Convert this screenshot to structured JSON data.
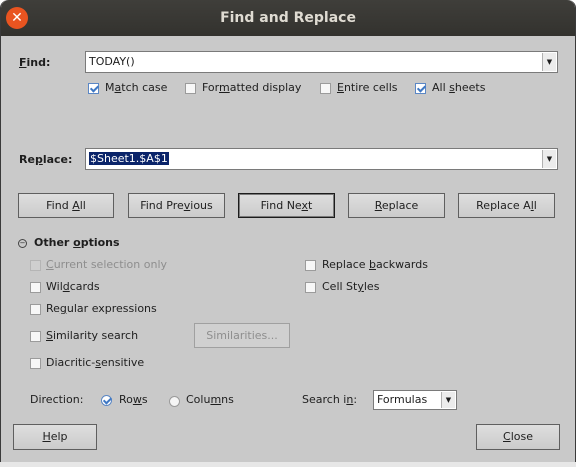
{
  "window": {
    "title": "Find and Replace"
  },
  "find": {
    "label_pre": "",
    "label_key": "F",
    "label_post": "ind:",
    "value": "TODAY()"
  },
  "find_options": {
    "match_case": {
      "pre": "M",
      "key": "a",
      "post": "tch case",
      "checked": true
    },
    "formatted_display": {
      "pre": "For",
      "key": "m",
      "post": "atted display",
      "checked": false
    },
    "entire_cells": {
      "pre": "",
      "key": "E",
      "post": "ntire cells",
      "checked": false
    },
    "all_sheets": {
      "pre": "All ",
      "key": "s",
      "post": "heets",
      "checked": true
    }
  },
  "replace": {
    "label_pre": "Re",
    "label_key": "p",
    "label_post": "lace:",
    "value": "$Sheet1.$A$1"
  },
  "buttons": {
    "find_all": {
      "pre": "Find ",
      "key": "A",
      "post": "ll"
    },
    "find_previous": {
      "pre": "Find Pre",
      "key": "v",
      "post": "ious"
    },
    "find_next": {
      "pre": "Find Ne",
      "key": "x",
      "post": "t"
    },
    "replace": {
      "pre": "",
      "key": "R",
      "post": "eplace"
    },
    "replace_all": {
      "pre": "Replace A",
      "key": "l",
      "post": "l"
    },
    "similarities": "Similarities...",
    "help": {
      "pre": "",
      "key": "H",
      "post": "elp"
    },
    "close": {
      "pre": "",
      "key": "C",
      "post": "lose"
    }
  },
  "other_options": {
    "header_pre": "Other ",
    "header_key": "o",
    "header_post": "ptions",
    "current_selection_only": {
      "pre": "",
      "key": "C",
      "post": "urrent selection only"
    },
    "replace_backwards": {
      "pre": "Replace ",
      "key": "b",
      "post": "ackwards"
    },
    "wildcards": {
      "pre": "Wil",
      "key": "d",
      "post": "cards"
    },
    "cell_styles": {
      "pre": "Cell St",
      "key": "y",
      "post": "les"
    },
    "regular_expressions": {
      "pre": "Re",
      "key": "g",
      "post": "ular expressions"
    },
    "similarity_search": {
      "pre": "",
      "key": "S",
      "post": "imilarity search"
    },
    "diacritic_sensitive": {
      "pre": "Diacritic-",
      "key": "s",
      "post": "ensitive"
    }
  },
  "direction": {
    "label": "Direction:",
    "rows": {
      "pre": "Ro",
      "key": "w",
      "post": "s",
      "selected": true
    },
    "columns": {
      "pre": "Colu",
      "key": "m",
      "post": "ns",
      "selected": false
    }
  },
  "search_in": {
    "label_pre": "Search i",
    "label_key": "n",
    "label_post": ":",
    "value": "Formulas"
  },
  "colors": {
    "accent": "#e95420",
    "check": "#3f78c4",
    "selection": "#0a246a"
  }
}
